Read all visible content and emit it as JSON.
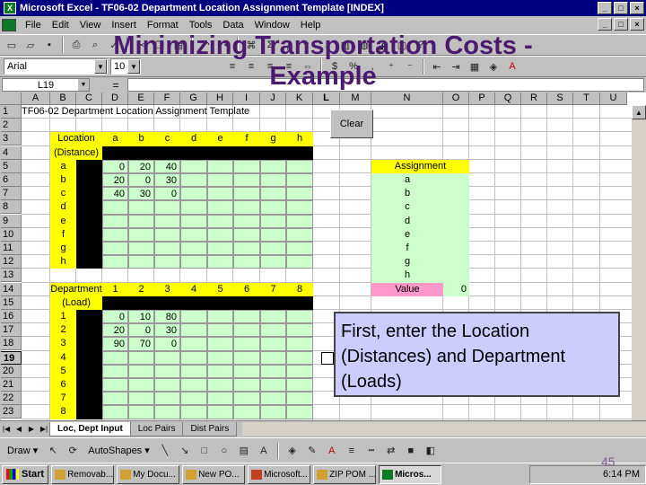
{
  "window": {
    "title": "Microsoft Excel - TF06-02 Department Location Assignment Template [INDEX]",
    "min": "_",
    "max": "□",
    "close": "×"
  },
  "slide": {
    "title_line1": "Minimizing Transportation Costs -",
    "title_line2": "Example",
    "page_number": "45"
  },
  "menu": [
    "File",
    "Edit",
    "View",
    "Insert",
    "Format",
    "Tools",
    "Data",
    "Window",
    "Help"
  ],
  "formatting": {
    "font": "Arial",
    "size": "10"
  },
  "formula_bar": {
    "name_box": "L19",
    "equals": "="
  },
  "columns": [
    "A",
    "B",
    "C",
    "D",
    "E",
    "F",
    "G",
    "H",
    "I",
    "J",
    "K",
    "L",
    "M",
    "N",
    "O",
    "P",
    "Q",
    "R",
    "S",
    "T",
    "U"
  ],
  "rows": [
    "1",
    "2",
    "3",
    "4",
    "5",
    "6",
    "7",
    "8",
    "9",
    "10",
    "11",
    "12",
    "13",
    "14",
    "15",
    "16",
    "17",
    "18",
    "19",
    "20",
    "21",
    "22",
    "23"
  ],
  "sheet": {
    "title": "TF06-02 Department Location Assignment Template",
    "location_table": {
      "header": "Location",
      "header2": "(Distance)",
      "cols": [
        "a",
        "b",
        "c",
        "d",
        "e",
        "f",
        "g",
        "h"
      ],
      "rows": [
        "a",
        "b",
        "c",
        "d",
        "e",
        "f",
        "g",
        "h"
      ],
      "values": [
        [
          "0",
          "20",
          "40"
        ],
        [
          "20",
          "0",
          "30"
        ],
        [
          "40",
          "30",
          "0"
        ]
      ]
    },
    "department_table": {
      "header": "Department",
      "header2": "(Load)",
      "cols": [
        "1",
        "2",
        "3",
        "4",
        "5",
        "6",
        "7",
        "8"
      ],
      "rows": [
        "1",
        "2",
        "3",
        "4",
        "5",
        "6",
        "7",
        "8"
      ],
      "values": [
        [
          "0",
          "10",
          "80"
        ],
        [
          "20",
          "0",
          "30"
        ],
        [
          "90",
          "70",
          "0"
        ]
      ]
    },
    "assignment": {
      "header": "Assignment",
      "rows": [
        "a",
        "b",
        "c",
        "d",
        "e",
        "f",
        "g",
        "h"
      ],
      "value_label": "Value",
      "value": "0"
    },
    "clear_button": "Clear"
  },
  "callout": "First, enter the Location (Distances) and Department (Loads)",
  "sheet_tabs": [
    "Loc, Dept Input",
    "Loc Pairs",
    "Dist Pairs"
  ],
  "drawing": {
    "draw": "Draw ▾",
    "autoshapes": "AutoShapes ▾"
  },
  "taskbar": {
    "start": "Start",
    "items": [
      "Removab...",
      "My Docu...",
      "New PO...",
      "Microsoft...",
      "ZIP POM ...",
      "Micros..."
    ],
    "clock": "6:14 PM"
  }
}
